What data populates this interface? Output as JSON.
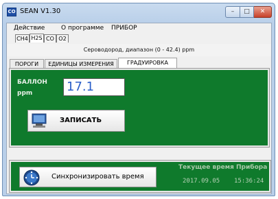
{
  "window": {
    "title": "SEAN V1.30",
    "app_icon_text": "CO"
  },
  "menu": {
    "items": [
      "Действие",
      "О программе",
      "ПРИБОР"
    ]
  },
  "gas_tabs": [
    {
      "label": "CH4",
      "active": false
    },
    {
      "label": "H2S",
      "active": true
    },
    {
      "label": "CO",
      "active": false
    },
    {
      "label": "O2",
      "active": false
    }
  ],
  "gas_description": "Сероводород, диапазон (0 - 42.4) ppm",
  "sub_tabs": [
    {
      "label": "ПОРОГИ",
      "active": false
    },
    {
      "label": "ЕДИНИЦЫ ИЗМЕРЕНИЯ",
      "active": false
    },
    {
      "label": "ГРАДУИРОВКА",
      "active": true
    }
  ],
  "calibration": {
    "label_line1": "БАЛЛОН",
    "label_line2": "ppm",
    "value": "17.1",
    "write_button": "ЗАПИСАТЬ"
  },
  "sync": {
    "button_label": "Синхронизировать время",
    "time_caption": "Текущее время Прибора",
    "date": "2017.09.05",
    "time": "15:36:24"
  },
  "colors": {
    "panel_green": "#0f7a2c",
    "value_blue": "#2b5fc9"
  }
}
